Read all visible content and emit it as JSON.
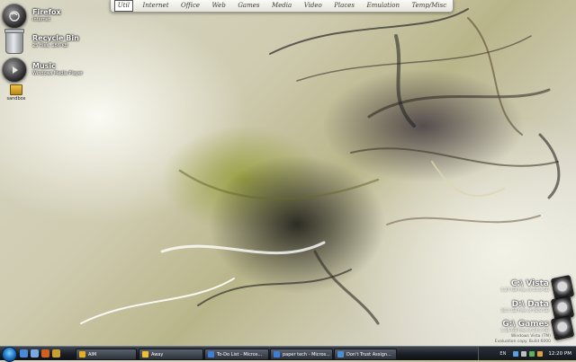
{
  "launcher": {
    "items": [
      "Util",
      "Internet",
      "Office",
      "Web",
      "Games",
      "Media",
      "Video",
      "Places",
      "Emulation",
      "Temp/Misc"
    ]
  },
  "desktop": {
    "firefox": {
      "title": "Firefox",
      "subtitle": "Internet",
      "icon": "firefox-orb-icon"
    },
    "recycle": {
      "title": "Recycle Bin",
      "subtitle": "25 files, 186 KB",
      "icon": "recycle-bin-icon"
    },
    "music": {
      "title": "Music",
      "subtitle": "Windows Media Player",
      "icon": "play-orb-icon"
    },
    "sandbox": {
      "label": "sandbox",
      "icon": "folder-icon"
    }
  },
  "drives": [
    {
      "title": "C:\\ Vista",
      "subtitle": "5.27 GB free of 33.8 GB",
      "icon": "hard-drive-icon"
    },
    {
      "title": "D:\\ Data",
      "subtitle": "16.1 GB free of 48.8 GB",
      "icon": "hard-drive-icon"
    },
    {
      "title": "G:\\ Games",
      "subtitle": "1.16 GB free of 24.2 GB",
      "icon": "hard-drive-icon"
    }
  ],
  "watermark": {
    "line1": "Windows Vista (TM)",
    "line2": "Evaluation copy. Build 6000"
  },
  "taskbar": {
    "buttons": [
      {
        "label": "AIM",
        "color": "#e8b020"
      },
      {
        "label": "Away",
        "color": "#f0c030"
      },
      {
        "label": "To-Do List - Micros...",
        "color": "#3d7fd8"
      },
      {
        "label": "paper tech - Micros...",
        "color": "#3d7fd8"
      },
      {
        "label": "Don't Trust Assign...",
        "color": "#4a90d0"
      }
    ],
    "language": "EN",
    "time": "12:20 PM"
  },
  "colors": {
    "start_orb": "#1a6fbd",
    "taskbar": "#1b1f25"
  }
}
